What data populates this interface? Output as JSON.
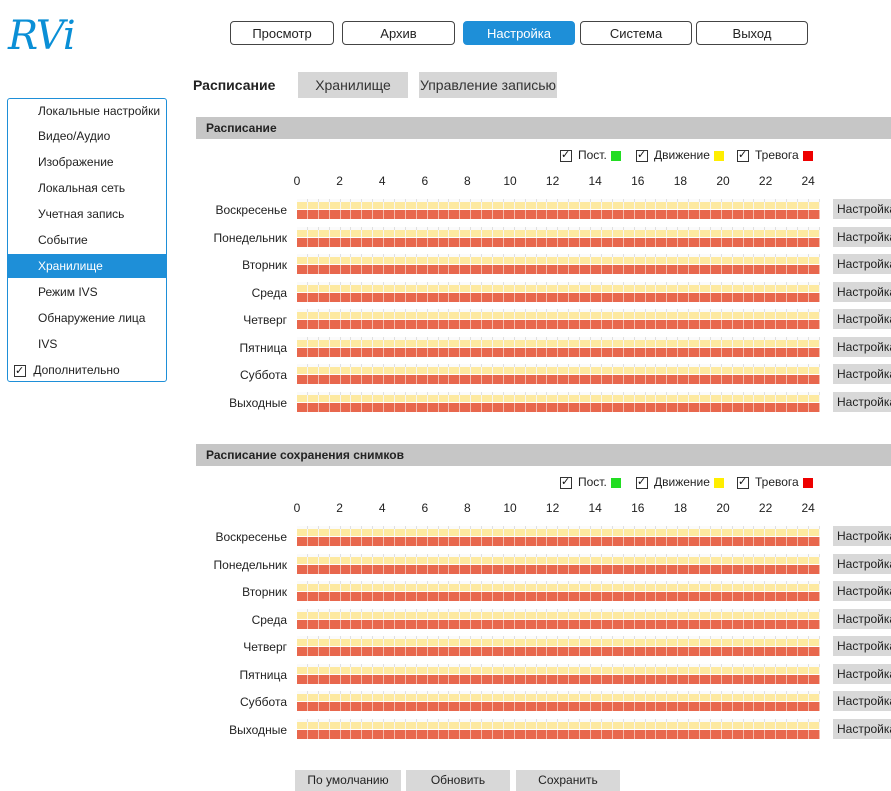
{
  "brand": {
    "logo_text": "RVi",
    "accent": "#1e8fd8"
  },
  "topnav": [
    "Просмотр",
    "Архив",
    "Настройка",
    "Система",
    "Выход"
  ],
  "subtabs": [
    "Расписание",
    "Хранилище",
    "Управление записью"
  ],
  "sidebar": {
    "items": [
      "Локальные настройки",
      "Видео/Аудио",
      "Изображение",
      "Локальная сеть",
      "Учетная запись",
      "Событие",
      "Хранилище",
      "Режим IVS",
      "Обнаружение лица",
      "IVS"
    ],
    "active": "Хранилище",
    "extra": "Дополнительно"
  },
  "legend": {
    "items": [
      {
        "label": "Пост.",
        "color": "#22dd22",
        "checked": true
      },
      {
        "label": "Движение",
        "color": "#ffee00",
        "checked": true
      },
      {
        "label": "Тревога",
        "color": "#ee0000",
        "checked": true
      }
    ]
  },
  "hours": [
    "0",
    "2",
    "4",
    "6",
    "8",
    "10",
    "12",
    "14",
    "16",
    "18",
    "20",
    "22",
    "24"
  ],
  "days": [
    "Воскресенье",
    "Понедельник",
    "Вторник",
    "Среда",
    "Четверг",
    "Пятница",
    "Суббота",
    "Выходные"
  ],
  "sections": [
    {
      "title": "Расписание"
    },
    {
      "title": "Расписание сохранения снимков"
    }
  ],
  "config_button": "Настройка",
  "bottom_buttons": [
    "По умолчанию",
    "Обновить",
    "Сохранить"
  ]
}
